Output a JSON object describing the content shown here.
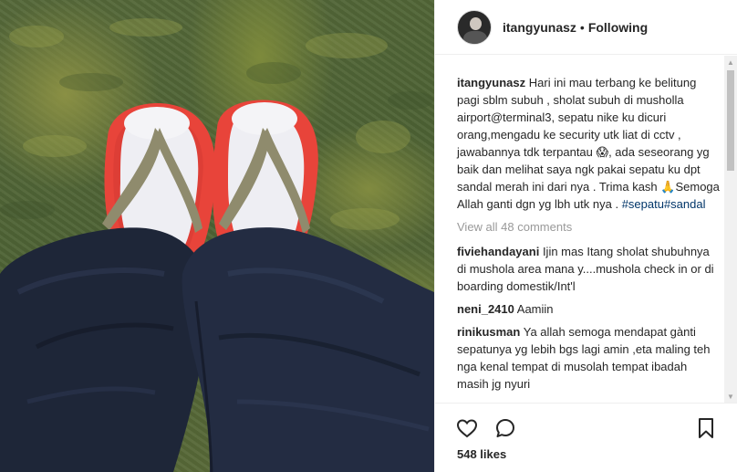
{
  "post": {
    "username": "itangyunasz",
    "separator": "•",
    "follow_status": "Following",
    "caption_user": "itangyunasz",
    "caption_text": "Hari ini mau terbang ke belitung pagi sblm subuh , sholat subuh di musholla airport@terminal3, sepatu nike ku dicuri orang,mengadu ke security utk liat di cctv , jawabannya tdk terpantau ",
    "caption_emoji_1": "😱",
    "caption_text_2": ", ada seseorang yg baik dan melihat saya ngk pakai sepatu ku dpt sandal merah ini dari nya . Trima kash ",
    "caption_emoji_2": "🙏",
    "caption_text_3": "Semoga Allah ganti dgn yg lbh utk nya . ",
    "hashtag_1": "#sepatu",
    "hashtag_2": "#sandal",
    "view_all": "View all 48 comments",
    "likes": "548 likes"
  },
  "comments": [
    {
      "user": "fiviehandayani",
      "text": "Ijin mas Itang sholat shubuhnya di mushola area mana y....mushola check in or di boarding domestik/Int'l"
    },
    {
      "user": "neni_2410",
      "text": "Aamiin"
    },
    {
      "user": "rinikusman",
      "text": "Ya allah semoga mendapat gànti sepatunya yg lebih bgs lagi amin ,eta maling teh nga kenal tempat di musolah tempat ibadah masih jg nyuri"
    }
  ],
  "icons": {
    "like": "heart-icon",
    "comment": "comment-bubble-icon",
    "save": "bookmark-icon",
    "scroll_up": "triangle-up-icon",
    "scroll_down": "triangle-down-icon"
  },
  "colors": {
    "text": "#262626",
    "muted": "#999999",
    "hashtag": "#003569",
    "sandal_red": "#e8443a",
    "jeans": "#1e2638"
  }
}
